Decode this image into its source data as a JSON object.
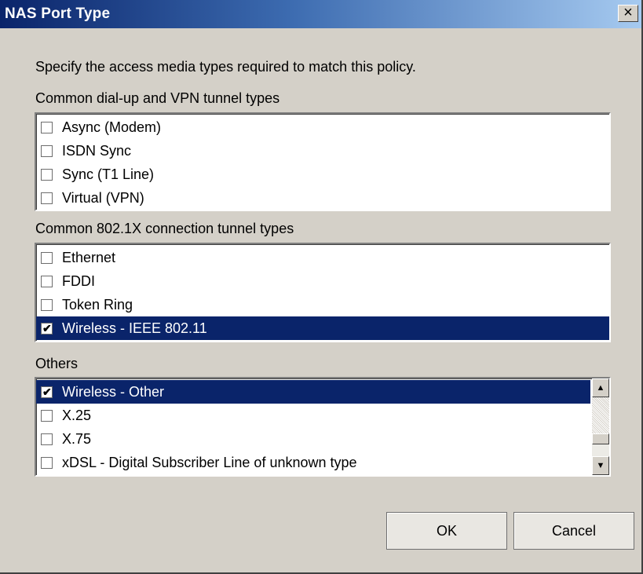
{
  "window": {
    "title": "NAS Port Type",
    "close_glyph": "×"
  },
  "instruction": "Specify the access media types required to match this policy.",
  "groups": [
    {
      "label": "Common dial-up and VPN tunnel types",
      "items": [
        {
          "label": "Async (Modem)",
          "checked": false,
          "selected": false
        },
        {
          "label": "ISDN Sync",
          "checked": false,
          "selected": false
        },
        {
          "label": "Sync (T1 Line)",
          "checked": false,
          "selected": false
        },
        {
          "label": "Virtual (VPN)",
          "checked": false,
          "selected": false
        }
      ]
    },
    {
      "label": "Common 802.1X connection tunnel types",
      "items": [
        {
          "label": "Ethernet",
          "checked": false,
          "selected": false
        },
        {
          "label": "FDDI",
          "checked": false,
          "selected": false
        },
        {
          "label": "Token Ring",
          "checked": false,
          "selected": false
        },
        {
          "label": "Wireless - IEEE 802.11",
          "checked": true,
          "selected": true
        }
      ]
    },
    {
      "label": "Others",
      "items": [
        {
          "label": "Wireless - Other",
          "checked": true,
          "selected": true
        },
        {
          "label": "X.25",
          "checked": false,
          "selected": false
        },
        {
          "label": "X.75",
          "checked": false,
          "selected": false
        },
        {
          "label": "xDSL - Digital Subscriber Line of unknown type",
          "checked": false,
          "selected": false
        }
      ]
    }
  ],
  "buttons": {
    "ok": "OK",
    "cancel": "Cancel"
  },
  "colors": {
    "selection": "#0a246a",
    "dialog_bg": "#d4d0c8"
  }
}
